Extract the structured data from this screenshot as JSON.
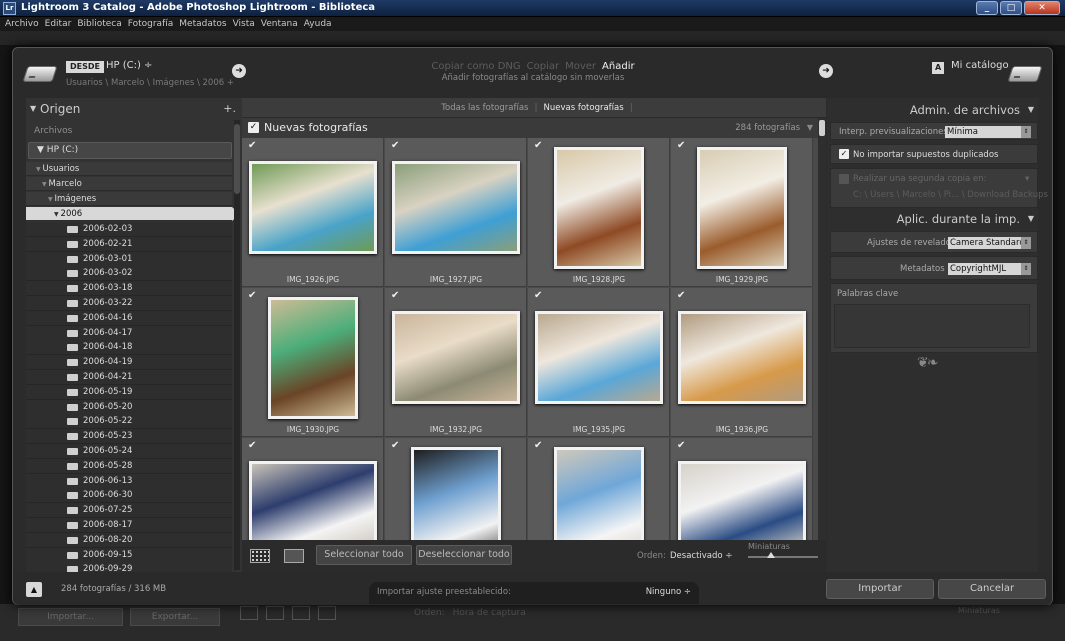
{
  "window": {
    "title": "Lightroom 3 Catalog - Adobe Photoshop Lightroom - Biblioteca",
    "app_icon": "Lr"
  },
  "menu": [
    "Archivo",
    "Editar",
    "Biblioteca",
    "Fotografía",
    "Metadatos",
    "Vista",
    "Ventana",
    "Ayuda"
  ],
  "background": {
    "import_btn": "Importar...",
    "export_btn": "Exportar...",
    "orden_label": "Orden:",
    "orden_value": "Hora de captura",
    "thumbs_label": "Miniaturas"
  },
  "header": {
    "source_badge": "DESDE",
    "source_drive": "HP (C:) ÷",
    "source_path": "Usuarios \\ Marcelo \\ Imágenes \\ 2006 +",
    "modes": [
      "Copiar como DNG",
      "Copiar",
      "Mover",
      "Añadir"
    ],
    "active_mode": "Añadir",
    "mode_description": "Añadir fotografías al catálogo sin moverlas",
    "dest_badge": "A",
    "dest_name": "Mi catálogo"
  },
  "left_panel": {
    "title": "Origen",
    "plus": "+.",
    "archivos": "Archivos",
    "drive": "HP (C:)",
    "tree": [
      {
        "label": "Usuarios",
        "indent": 0
      },
      {
        "label": "Marcelo",
        "indent": 1
      },
      {
        "label": "Imágenes",
        "indent": 2
      },
      {
        "label": "2006",
        "indent": 3,
        "selected": true
      }
    ],
    "folders": [
      "2006-02-03",
      "2006-02-21",
      "2006-03-01",
      "2006-03-02",
      "2006-03-18",
      "2006-03-22",
      "2006-04-16",
      "2006-04-17",
      "2006-04-18",
      "2006-04-19",
      "2006-04-21",
      "2006-05-19",
      "2006-05-20",
      "2006-05-22",
      "2006-05-23",
      "2006-05-24",
      "2006-05-28",
      "2006-06-13",
      "2006-06-30",
      "2006-07-25",
      "2006-08-17",
      "2006-08-20",
      "2006-09-15",
      "2006-09-29"
    ]
  },
  "center": {
    "tabs": [
      "Todas las fotografías",
      "Nuevas fotografías"
    ],
    "active_tab": "Nuevas fotografías",
    "section_title": "Nuevas fotografías",
    "photo_count": "284 fotografías",
    "photos": [
      {
        "name": "IMG_1926.JPG",
        "orientation": "landscape",
        "colors": [
          "#6f9a55",
          "#49a3c9",
          "#e8e0cf"
        ]
      },
      {
        "name": "IMG_1927.JPG",
        "orientation": "landscape",
        "colors": [
          "#8a9f7a",
          "#3f9fd4",
          "#d9d2c2"
        ]
      },
      {
        "name": "IMG_1928.JPG",
        "orientation": "portrait",
        "colors": [
          "#d8c8a8",
          "#8e4a24",
          "#f0ece4"
        ]
      },
      {
        "name": "IMG_1929.JPG",
        "orientation": "portrait",
        "colors": [
          "#d8cdb4",
          "#9a5c2c",
          "#f2eee4"
        ]
      },
      {
        "name": "IMG_1930.JPG",
        "orientation": "portrait",
        "colors": [
          "#cdbb94",
          "#6a4426",
          "#4cae7a"
        ]
      },
      {
        "name": "IMG_1932.JPG",
        "orientation": "landscape",
        "colors": [
          "#c9b59a",
          "#8c8a73",
          "#e9dcc8"
        ]
      },
      {
        "name": "IMG_1935.JPG",
        "orientation": "landscape",
        "colors": [
          "#b8a890",
          "#5aa7d8",
          "#efe7dc"
        ]
      },
      {
        "name": "IMG_1936.JPG",
        "orientation": "landscape",
        "colors": [
          "#b09b80",
          "#d79a4a",
          "#efe8de"
        ]
      },
      {
        "name": "",
        "orientation": "landscape",
        "colors": [
          "#c9c3b8",
          "#f4f4f4",
          "#2d3d6d"
        ]
      },
      {
        "name": "",
        "orientation": "portrait",
        "colors": [
          "#1e1e1e",
          "#f2f2f2",
          "#6fa0d0"
        ]
      },
      {
        "name": "",
        "orientation": "portrait",
        "colors": [
          "#cfc8bb",
          "#f5f5f5",
          "#6fa7d8"
        ]
      },
      {
        "name": "",
        "orientation": "landscape",
        "colors": [
          "#d6d2ca",
          "#2a4c84",
          "#f2f2f2"
        ]
      }
    ],
    "footer": {
      "select_all": "Seleccionar todo",
      "deselect_all": "Deseleccionar todo",
      "orden_label": "Orden:",
      "orden_value": "Desactivado ÷",
      "thumbs_label": "Miniaturas"
    }
  },
  "right_panel": {
    "file_handling_title": "Admin. de archivos",
    "preview_label": "Interp. previsualizaciones:",
    "preview_value": "Mínima",
    "no_duplicates": "No importar supuestos duplicados",
    "second_copy": "Realizar una segunda copia en:",
    "second_copy_path": "C: \\ Users \\ Marcelo \\ Pi... \\ Download Backups",
    "apply_title": "Aplic. durante la imp.",
    "develop_label": "Ajustes de revelado",
    "develop_value": "Camera Standard",
    "metadata_label": "Metadatos",
    "metadata_value": "CopyrightMJL",
    "keywords_label": "Palabras clave"
  },
  "bottom": {
    "summary": "284 fotografías / 316 MB",
    "preset_label": "Importar ajuste preestablecido:",
    "preset_value": "Ninguno ÷",
    "import_btn": "Importar",
    "cancel_btn": "Cancelar"
  }
}
